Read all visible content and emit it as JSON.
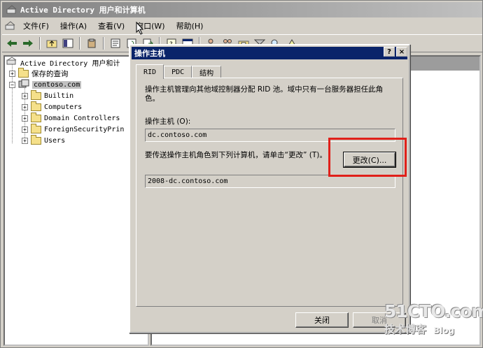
{
  "window": {
    "title": "Active Directory 用户和计算机"
  },
  "menu": [
    "文件(F)",
    "操作(A)",
    "查看(V)",
    "窗口(W)",
    "帮助(H)"
  ],
  "tree": {
    "root": "Active Directory 用户和计",
    "saved_queries": "保存的查询",
    "domain": "contoso.com",
    "children": [
      "Builtin",
      "Computers",
      "Domain Controllers",
      "ForeignSecurityPrin",
      "Users"
    ]
  },
  "dialog": {
    "title": "操作主机",
    "help_btn": "?",
    "close_btn": "×",
    "tabs": [
      "RID",
      "PDC",
      "结构"
    ],
    "description": "操作主机管理向其他域控制器分配 RID 池。域中只有一台服务器担任此角色。",
    "master_label": "操作主机 (O):",
    "master_value": "dc.contoso.com",
    "transfer_label": "要传送操作主机角色到下列计算机，请单击“更改” (T)。",
    "change_button": "更改(C)...",
    "target_value": "2008-dc.contoso.com",
    "close_button": "关闭",
    "cancel_button": "取消"
  },
  "watermark": {
    "site": "51CTO.com",
    "sub1": "技术博客",
    "sub2": "Blog"
  },
  "colors": {
    "highlight": "#e0201a",
    "dialog_title": "#0a246a"
  }
}
